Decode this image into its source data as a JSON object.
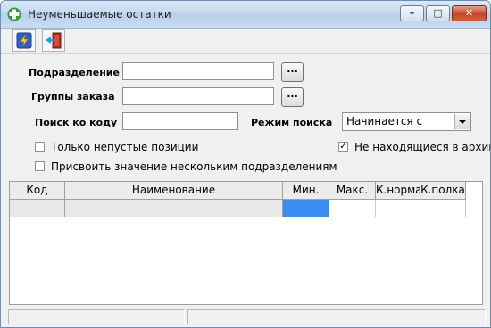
{
  "window": {
    "title": "Неуменьшаемые остатки",
    "controls": {
      "minimize": "–",
      "maximize": "□",
      "close": "✕"
    }
  },
  "toolbar": {
    "buttons": [
      {
        "icon": "lightning-icon"
      },
      {
        "icon": "exit-door-icon"
      }
    ]
  },
  "form": {
    "department_label": "Подразделение",
    "department_value": "",
    "department_browse": "...",
    "order_groups_label": "Группы заказа",
    "order_groups_value": "",
    "order_groups_browse": "...",
    "code_search_label": "Поиск ко коду",
    "code_search_value": "",
    "search_mode_label": "Режим поиска",
    "search_mode_value": "Начинается с",
    "only_nonempty_label": "Только непустые позиции",
    "only_nonempty_checked": false,
    "not_archived_label": "Не находящиеся в архиве",
    "not_archived_checked": true,
    "assign_multiple_label": "Присвоить значение нескольким подразделениям",
    "assign_multiple_checked": false
  },
  "grid": {
    "columns": [
      "Код",
      "Наименование",
      "Мин.",
      "Макс.",
      "К.норма",
      "К.полка"
    ],
    "rows": [
      [
        "",
        "",
        "",
        "",
        "",
        ""
      ]
    ]
  },
  "colors": {
    "selection": "#3b8df0",
    "title_bar": "#c6d9f0",
    "close_button": "#c7452b"
  }
}
